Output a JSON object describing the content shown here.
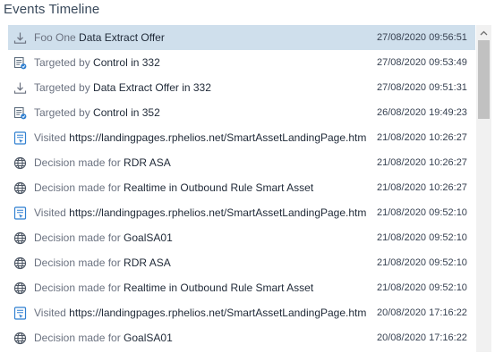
{
  "panel": {
    "title": "Events Timeline"
  },
  "events": [
    {
      "icon": "download-icon",
      "prefix": "Foo One ",
      "entity": "Data Extract Offer",
      "date": "27/08/2020 09:56:51",
      "selected": true
    },
    {
      "icon": "targeted-form-icon",
      "prefix": "Targeted by ",
      "entity": "Control in 332",
      "date": "27/08/2020 09:53:49"
    },
    {
      "icon": "download-icon",
      "prefix": "Targeted by ",
      "entity": "Data Extract Offer in 332",
      "date": "27/08/2020 09:51:31"
    },
    {
      "icon": "targeted-form-icon",
      "prefix": "Targeted by ",
      "entity": "Control in 352",
      "date": "26/08/2020 19:49:23"
    },
    {
      "icon": "page-visit-icon",
      "prefix": "Visited ",
      "entity": "https://landingpages.rphelios.net/SmartAssetLandingPage.htm",
      "date": "21/08/2020 10:26:27"
    },
    {
      "icon": "globe-icon",
      "prefix": "Decision made for ",
      "entity": "RDR ASA",
      "date": "21/08/2020 10:26:27"
    },
    {
      "icon": "globe-icon",
      "prefix": "Decision made for ",
      "entity": "Realtime in Outbound Rule Smart Asset",
      "date": "21/08/2020 10:26:27"
    },
    {
      "icon": "page-visit-icon",
      "prefix": "Visited ",
      "entity": "https://landingpages.rphelios.net/SmartAssetLandingPage.htm",
      "date": "21/08/2020 09:52:10"
    },
    {
      "icon": "globe-icon",
      "prefix": "Decision made for ",
      "entity": "GoalSA01",
      "date": "21/08/2020 09:52:10"
    },
    {
      "icon": "globe-icon",
      "prefix": "Decision made for ",
      "entity": "RDR ASA",
      "date": "21/08/2020 09:52:10"
    },
    {
      "icon": "globe-icon",
      "prefix": "Decision made for ",
      "entity": "Realtime in Outbound Rule Smart Asset",
      "date": "21/08/2020 09:52:10"
    },
    {
      "icon": "page-visit-icon",
      "prefix": "Visited ",
      "entity": "https://landingpages.rphelios.net/SmartAssetLandingPage.htm",
      "date": "20/08/2020 17:16:22"
    },
    {
      "icon": "globe-icon",
      "prefix": "Decision made for ",
      "entity": "GoalSA01",
      "date": "20/08/2020 17:16:22"
    }
  ],
  "colors": {
    "selected_row": "#cfdfec",
    "icon_gray": "#6b7280",
    "icon_blue": "#2f7fd0"
  }
}
